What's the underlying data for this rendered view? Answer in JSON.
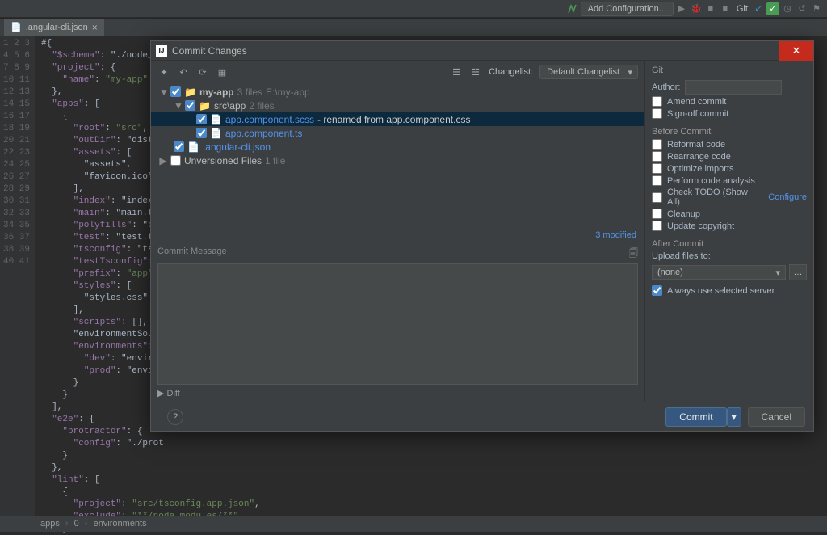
{
  "topbar": {
    "add_config": "Add Configuration...",
    "git_label": "Git:"
  },
  "tab": {
    "name": ".angular-cli.json"
  },
  "dialog": {
    "title": "Commit Changes",
    "changelist_label": "Changelist:",
    "changelist_value": "Default Changelist",
    "git_label": "Git",
    "tree": {
      "root": {
        "name": "my-app",
        "count": "3 files",
        "path": "E:\\my-app"
      },
      "srcapp": {
        "name": "src\\app",
        "count": "2 files"
      },
      "file1": {
        "name": "app.component.scss",
        "note": "- renamed from app.component.css"
      },
      "file2": {
        "name": "app.component.ts"
      },
      "file3": {
        "name": ".angular-cli.json"
      },
      "unversioned": {
        "name": "Unversioned Files",
        "count": "1 file"
      }
    },
    "modified": "3 modified",
    "commit_msg_label": "Commit Message",
    "diff_label": "Diff",
    "right": {
      "author_label": "Author:",
      "amend": "Amend commit",
      "signoff": "Sign-off commit",
      "before": "Before Commit",
      "reformat": "Reformat code",
      "rearrange": "Rearrange code",
      "optimize": "Optimize imports",
      "analysis": "Perform code analysis",
      "todo": "Check TODO (Show All)",
      "configure": "Configure",
      "cleanup": "Cleanup",
      "copyright": "Update copyright",
      "after": "After Commit",
      "upload_label": "Upload files to:",
      "upload_value": "(none)",
      "always": "Always use selected server"
    },
    "commit_btn": "Commit",
    "cancel_btn": "Cancel"
  },
  "editor": {
    "lines": [
      "#{",
      "  \"$schema\": \"./node_mo",
      "  \"project\": {",
      "    \"name\": \"my-app\"",
      "  },",
      "  \"apps\": [",
      "    {",
      "      \"root\": \"src\",",
      "      \"outDir\": \"dist.",
      "      \"assets\": [",
      "        \"assets\",",
      "        \"favicon.ico\"",
      "      ],",
      "      \"index\": \"index.h",
      "      \"main\": \"main.ts",
      "      \"polyfills\": \"po",
      "      \"test\": \"test.ts",
      "      \"tsconfig\": \"tsc",
      "      \"testTsconfig\":",
      "      \"prefix\": \"app\",",
      "      \"styles\": [",
      "        \"styles.css\"",
      "      ],",
      "      \"scripts\": [],",
      "      \"environmentSourc",
      "      \"environments\":",
      "        \"dev\": \"enviror",
      "        \"prod\": \"envirc",
      "      }",
      "    }",
      "  ],",
      "  \"e2e\": {",
      "    \"protractor\": {",
      "      \"config\": \"./prot",
      "    }",
      "  },",
      "  \"lint\": [",
      "    {",
      "      \"project\": \"src/tsconfig.app.json\",",
      "      \"exclude\": \"**/node_modules/**\"",
      "    },"
    ]
  },
  "breadcrumbs": {
    "a": "apps",
    "b": "0",
    "c": "environments"
  }
}
